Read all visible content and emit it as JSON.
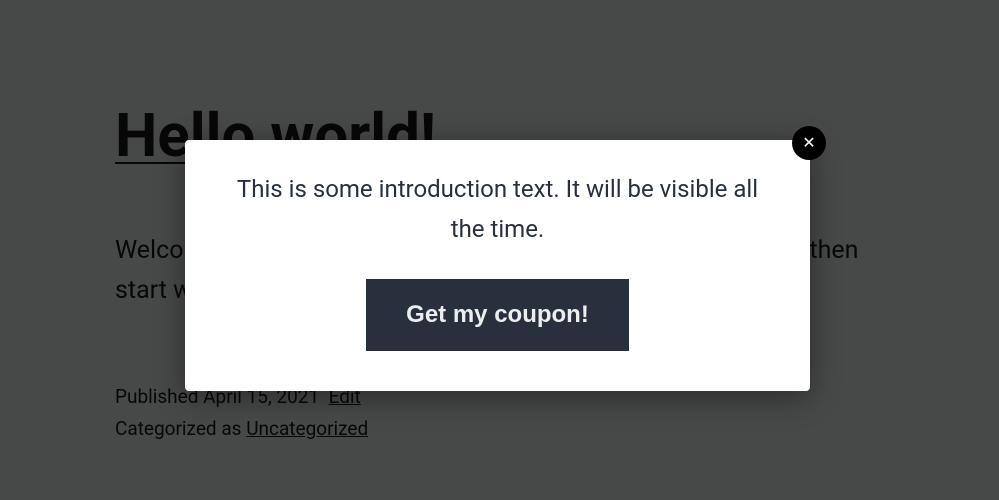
{
  "post": {
    "title": "Hello world!",
    "body": "Welcome to WordPress. This is your first post. Edit or delete it, then start writing!",
    "published_label": "Published",
    "date": "April 15, 2021",
    "edit_label": "Edit",
    "categorized_label": "Categorized as",
    "category": "Uncategorized"
  },
  "modal": {
    "intro_text": "This is some introduction text. It will be visible all the time.",
    "button_label": "Get my coupon!",
    "close_glyph": "✕"
  }
}
